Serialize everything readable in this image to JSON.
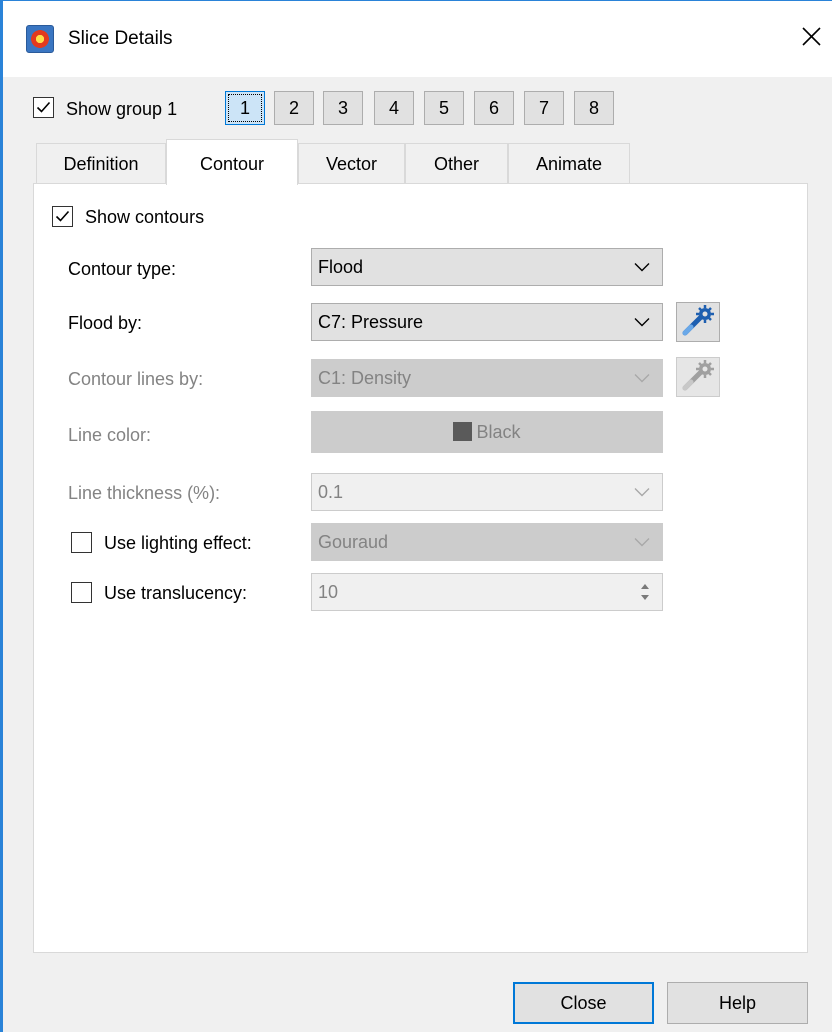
{
  "window": {
    "title": "Slice Details",
    "close_glyph": "✕"
  },
  "group": {
    "show_label": "Show group 1",
    "show_checked": true,
    "buttons": [
      "1",
      "2",
      "3",
      "4",
      "5",
      "6",
      "7",
      "8"
    ],
    "selected": "1"
  },
  "tabs": [
    {
      "label": "Definition",
      "active": false
    },
    {
      "label": "Contour",
      "active": true
    },
    {
      "label": "Vector",
      "active": false
    },
    {
      "label": "Other",
      "active": false
    },
    {
      "label": "Animate",
      "active": false
    }
  ],
  "contour": {
    "show_contours": {
      "label": "Show contours",
      "checked": true
    },
    "contour_type": {
      "label": "Contour type:",
      "value": "Flood"
    },
    "flood_by": {
      "label": "Flood by:",
      "value": "C7: Pressure"
    },
    "contour_lines_by": {
      "label": "Contour lines by:",
      "value": "C1: Density",
      "enabled": false
    },
    "line_color": {
      "label": "Line color:",
      "value": "Black",
      "swatch_color": "#5a5a5a",
      "enabled": false
    },
    "line_thickness": {
      "label": "Line thickness (%):",
      "value": "0.1",
      "enabled": false
    },
    "lighting": {
      "label": "Use lighting effect:",
      "checked": false,
      "value": "Gouraud",
      "enabled": false
    },
    "translucency": {
      "label": "Use translucency:",
      "checked": false,
      "value": "10",
      "enabled": false
    }
  },
  "icons": {
    "app": "tecplot-app-icon",
    "wand": "magic-wand-gear-icon"
  },
  "footer": {
    "close_label": "Close",
    "help_label": "Help"
  },
  "colors": {
    "accent": "#0078d7",
    "active_group_bg": "#cce4f7",
    "disabled_text": "#838383",
    "window_border": "#2a83d8"
  }
}
